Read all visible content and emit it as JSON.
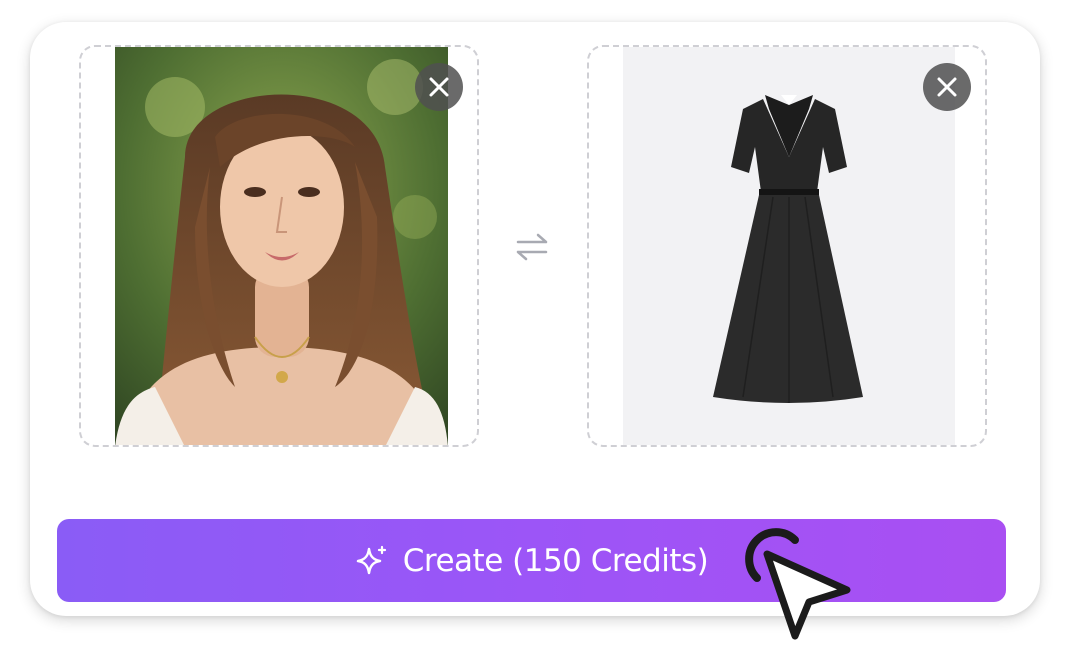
{
  "person_slot": {
    "image_alt": "Uploaded person photo",
    "close_icon": "close-icon"
  },
  "garment_slot": {
    "image_alt": "Uploaded garment photo",
    "close_icon": "close-icon"
  },
  "swap": {
    "icon": "swap-arrows-icon"
  },
  "create_button": {
    "icon": "sparkles-icon",
    "label": "Create (150 Credits)"
  },
  "colors": {
    "accent_start": "#8a5cf6",
    "accent_end": "#a94ff2",
    "close_bg": "#505050",
    "dashed_border": "#cfcfd4"
  }
}
